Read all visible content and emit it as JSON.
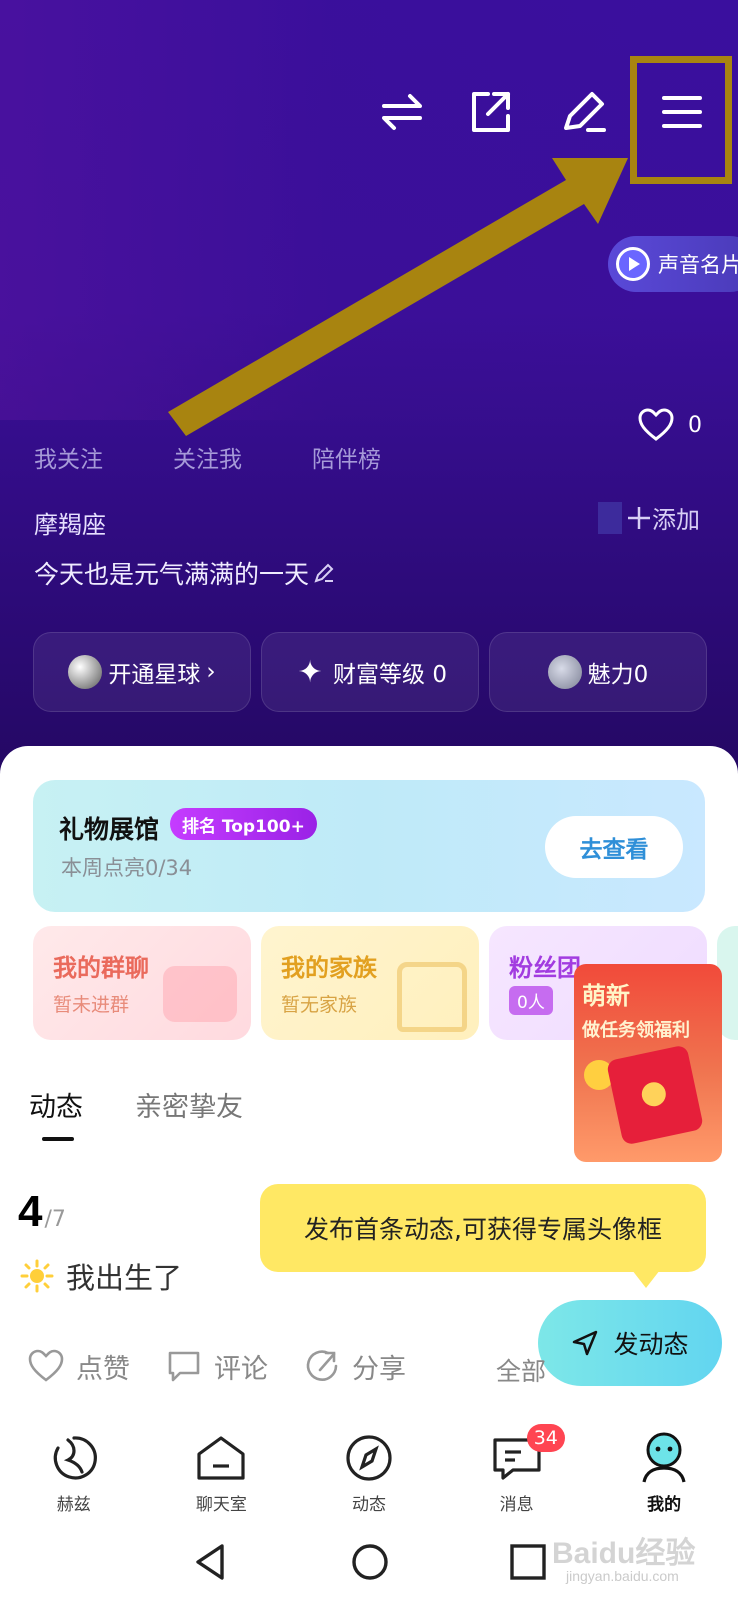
{
  "header": {
    "icons": [
      "swap-icon",
      "share-icon",
      "edit-icon",
      "menu-icon"
    ],
    "voice_card_label": "声音名片",
    "likes_count": "0",
    "follow_tabs": [
      "我关注",
      "关注我",
      "陪伴榜"
    ],
    "zodiac": "摩羯座",
    "add_tag_label": "添加",
    "signature": "今天也是元气满满的一天",
    "stats": {
      "planet": "开通星球",
      "planet_chevron": "›",
      "wealth": "财富等级 0",
      "charm": "魅力0"
    }
  },
  "gift_card": {
    "title": "礼物展馆",
    "badge": "排名 Top100+",
    "subtitle": "本周点亮0/34",
    "button": "去查看"
  },
  "features": {
    "group_chat": {
      "title": "我的群聊",
      "subtitle": "暂未进群"
    },
    "family": {
      "title": "我的家族",
      "subtitle": "暂无家族"
    },
    "fan_club": {
      "title": "粉丝团",
      "count": "0人"
    }
  },
  "promo": {
    "line1": "萌新",
    "line2": "做任务领福利"
  },
  "content_tabs": [
    "动态",
    "亲密挚友"
  ],
  "progress": {
    "current": "4",
    "total": "/7"
  },
  "milestone": "我出生了",
  "tooltip": "发布首条动态,可获得专属头像框",
  "post_button": "发动态",
  "actions": {
    "like": "点赞",
    "comment": "评论",
    "share": "分享",
    "all": "全部"
  },
  "bottom_nav": [
    {
      "label": "赫兹",
      "icon": "hertz-icon"
    },
    {
      "label": "聊天室",
      "icon": "chatroom-icon"
    },
    {
      "label": "动态",
      "icon": "compass-icon"
    },
    {
      "label": "消息",
      "icon": "message-icon",
      "badge": "34"
    },
    {
      "label": "我的",
      "icon": "profile-icon",
      "active": true
    }
  ],
  "watermark": {
    "main": "Baidu经验",
    "sub": "jingyan.baidu.com"
  },
  "colors": {
    "header": "#3a0f9e",
    "highlight": "#a88410",
    "tooltip": "#ffe864",
    "post_button": "#62d5f0",
    "badge": "#ff4552"
  }
}
